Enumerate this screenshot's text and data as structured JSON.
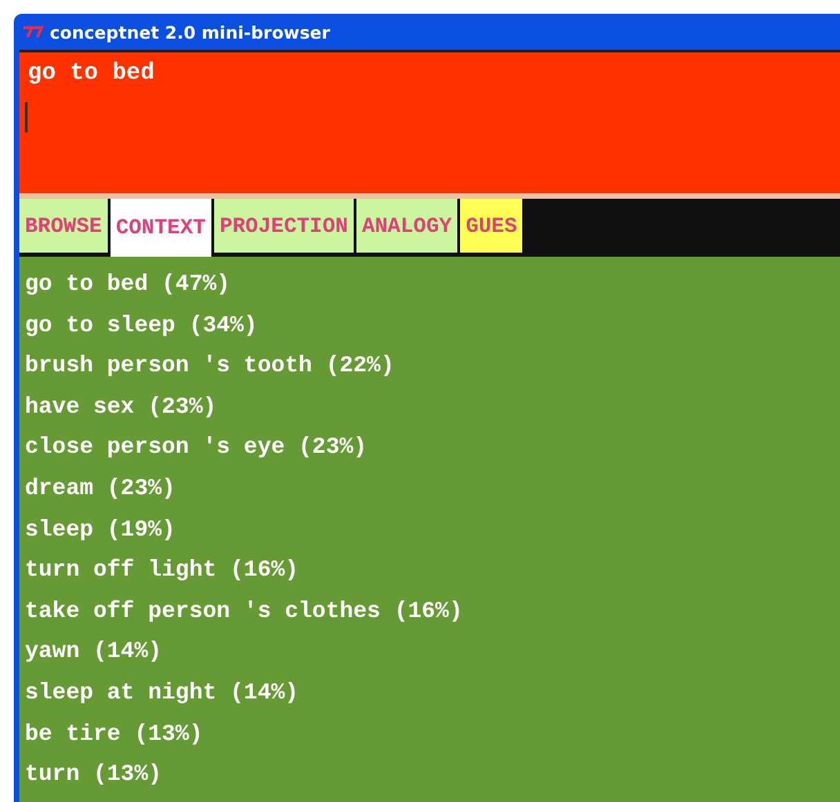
{
  "window": {
    "title": "conceptnet 2.0 mini-browser"
  },
  "query": {
    "value": "go to bed"
  },
  "tabs": [
    {
      "label": "BROWSE",
      "selected": false,
      "kind": "normal"
    },
    {
      "label": "CONTEXT",
      "selected": true,
      "kind": "normal"
    },
    {
      "label": "PROJECTION",
      "selected": false,
      "kind": "normal"
    },
    {
      "label": "ANALOGY",
      "selected": false,
      "kind": "normal"
    },
    {
      "label": "GUES",
      "selected": false,
      "kind": "highlight"
    }
  ],
  "results": [
    "go to bed (47%)",
    "go to sleep (34%)",
    "brush person 's tooth (22%)",
    "have sex (23%)",
    "close person 's eye (23%)",
    "dream (23%)",
    "sleep (19%)",
    "turn off light (16%)",
    "take off person 's clothes (16%)",
    "yawn (14%)",
    "sleep at night (14%)",
    "be tire (13%)",
    "turn (13%)"
  ]
}
